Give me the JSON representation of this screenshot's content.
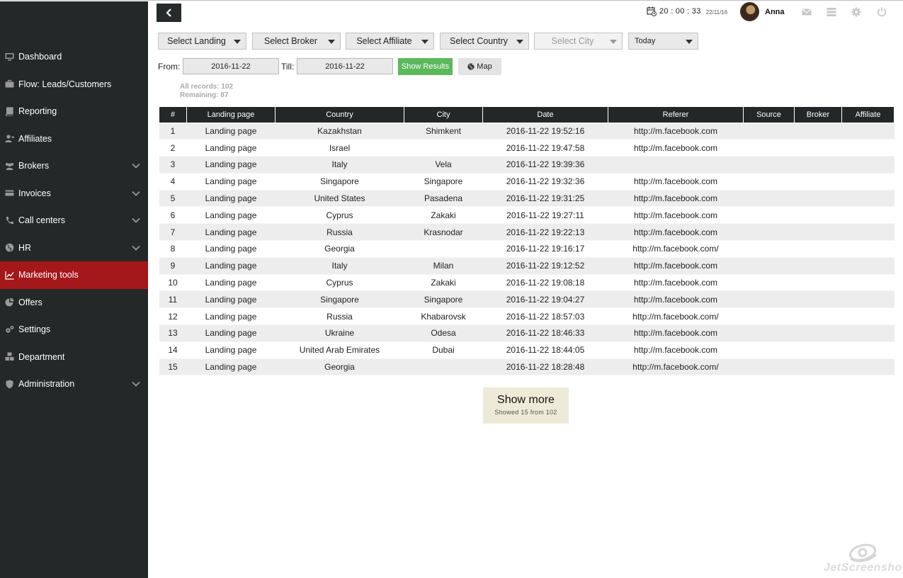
{
  "topbar": {
    "time": "20 : 00 : 33",
    "date": "22/11/16",
    "user_name": "Anna"
  },
  "sidebar": {
    "items": [
      {
        "label": "Dashboard",
        "icon": "monitor-icon",
        "expandable": false,
        "active": false
      },
      {
        "label": "Flow: Leads/Customers",
        "icon": "briefcase-icon",
        "expandable": false,
        "active": false
      },
      {
        "label": "Reporting",
        "icon": "book-icon",
        "expandable": false,
        "active": false
      },
      {
        "label": "Affiliates",
        "icon": "user-plus-icon",
        "expandable": false,
        "active": false
      },
      {
        "label": "Brokers",
        "icon": "users-icon",
        "expandable": true,
        "active": false
      },
      {
        "label": "Invoices",
        "icon": "credit-card-icon",
        "expandable": true,
        "active": false
      },
      {
        "label": "Call centers",
        "icon": "phone-icon",
        "expandable": true,
        "active": false
      },
      {
        "label": "HR",
        "icon": "globe-icon",
        "expandable": true,
        "active": false
      },
      {
        "label": "Marketing tools",
        "icon": "line-chart-icon",
        "expandable": false,
        "active": true
      },
      {
        "label": "Offers",
        "icon": "pie-chart-icon",
        "expandable": false,
        "active": false
      },
      {
        "label": "Settings",
        "icon": "cogs-icon",
        "expandable": false,
        "active": false
      },
      {
        "label": "Department",
        "icon": "cubes-icon",
        "expandable": false,
        "active": false
      },
      {
        "label": "Administration",
        "icon": "shield-icon",
        "expandable": true,
        "active": false
      }
    ],
    "colors": {
      "background": "#242828",
      "active": "#a4171b"
    }
  },
  "filters": {
    "landing": "Select Landing",
    "broker": "Select Broker",
    "affiliate": "Select Affiliate",
    "country": "Select Country",
    "city": "Select City",
    "period": "Today",
    "from_label": "From:",
    "from_value": "2016-11-22",
    "till_label": "Till:",
    "till_value": "2016-11-22",
    "show_results": "Show Results",
    "map": "Map"
  },
  "stats": {
    "all_records": "All records: 102",
    "remaining": "Remaining: 87"
  },
  "table": {
    "headers": [
      "#",
      "Landing page",
      "Country",
      "City",
      "Date",
      "Referer",
      "Source",
      "Broker",
      "Affiliate"
    ],
    "rows": [
      [
        "1",
        "Landing page",
        "Kazakhstan",
        "Shimkent",
        "2016-11-22 19:52:16",
        "http://m.facebook.com",
        "",
        "",
        ""
      ],
      [
        "2",
        "Landing page",
        "Israel",
        "",
        "2016-11-22 19:47:58",
        "http://m.facebook.com",
        "",
        "",
        ""
      ],
      [
        "3",
        "Landing page",
        "Italy",
        "Vela",
        "2016-11-22 19:39:36",
        "",
        "",
        "",
        ""
      ],
      [
        "4",
        "Landing page",
        "Singapore",
        "Singapore",
        "2016-11-22 19:32:36",
        "http://m.facebook.com",
        "",
        "",
        ""
      ],
      [
        "5",
        "Landing page",
        "United States",
        "Pasadena",
        "2016-11-22 19:31:25",
        "http://m.facebook.com",
        "",
        "",
        ""
      ],
      [
        "6",
        "Landing page",
        "Cyprus",
        "Zakaki",
        "2016-11-22 19:27:11",
        "http://m.facebook.com",
        "",
        "",
        ""
      ],
      [
        "7",
        "Landing page",
        "Russia",
        "Krasnodar",
        "2016-11-22 19:22:13",
        "http://m.facebook.com",
        "",
        "",
        ""
      ],
      [
        "8",
        "Landing page",
        "Georgia",
        "",
        "2016-11-22 19:16:17",
        "http://m.facebook.com/",
        "",
        "",
        ""
      ],
      [
        "9",
        "Landing page",
        "Italy",
        "Milan",
        "2016-11-22 19:12:52",
        "http://m.facebook.com",
        "",
        "",
        ""
      ],
      [
        "10",
        "Landing page",
        "Cyprus",
        "Zakaki",
        "2016-11-22 19:08:18",
        "http://m.facebook.com",
        "",
        "",
        ""
      ],
      [
        "11",
        "Landing page",
        "Singapore",
        "Singapore",
        "2016-11-22 19:04:27",
        "http://m.facebook.com",
        "",
        "",
        ""
      ],
      [
        "12",
        "Landing page",
        "Russia",
        "Khabarovsk",
        "2016-11-22 18:57:03",
        "http://m.facebook.com/",
        "",
        "",
        ""
      ],
      [
        "13",
        "Landing page",
        "Ukraine",
        "Odesa",
        "2016-11-22 18:46:33",
        "http://m.facebook.com",
        "",
        "",
        ""
      ],
      [
        "14",
        "Landing page",
        "United Arab Emirates",
        "Dubai",
        "2016-11-22 18:44:05",
        "http://m.facebook.com",
        "",
        "",
        ""
      ],
      [
        "15",
        "Landing page",
        "Georgia",
        "",
        "2016-11-22 18:28:48",
        "http://m.facebook.com/",
        "",
        "",
        ""
      ]
    ]
  },
  "show_more": {
    "label": "Show more",
    "sub": "Showed 15 from 102"
  },
  "watermark": {
    "text": "JetScreenshot",
    "suffix": ".com"
  }
}
